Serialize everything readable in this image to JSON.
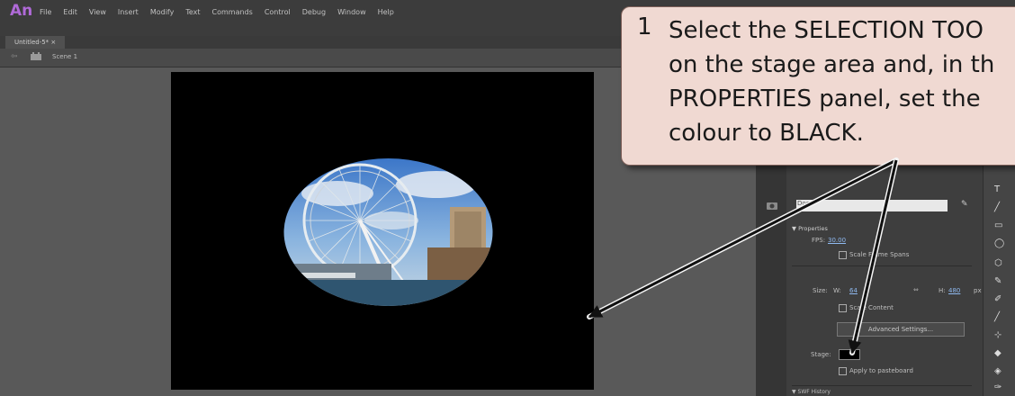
{
  "app": {
    "logo": "An",
    "menu": [
      "File",
      "Edit",
      "View",
      "Insert",
      "Modify",
      "Text",
      "Commands",
      "Control",
      "Debug",
      "Window",
      "Help"
    ]
  },
  "doc_tab": {
    "label": "Untitled-5* ×"
  },
  "scene": {
    "label": "Scene 1"
  },
  "properties_panel": {
    "doc_label": "Doc",
    "section_properties": "▼ Properties",
    "fps_label": "FPS:",
    "fps_value": "30.00",
    "scale_spans_label": "Scale Frame Spans",
    "size_label": "Size:",
    "w_label": "W:",
    "w_value": "64",
    "h_label": "H:",
    "h_value": "480",
    "unit": "px",
    "scale_content_label": "Scale Content",
    "advanced_settings_label": "Advanced Settings...",
    "stage_label": "Stage:",
    "stage_color": "#000000",
    "apply_pasteboard_label": "Apply to pasteboard",
    "swf_history_label": "▼ SWF History"
  },
  "callout": {
    "number": "1",
    "text": "Select the SELECTION TOO\non the stage area and, in th\nPROPERTIES panel, set the\ncolour to BLACK."
  },
  "colors": {
    "accent_logo": "#b06ad8",
    "callout_bg": "#f0d9d2",
    "stage_bg": "#000000"
  }
}
